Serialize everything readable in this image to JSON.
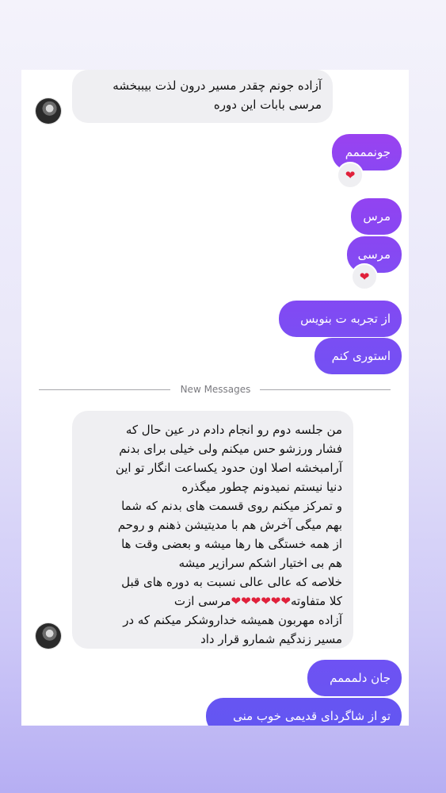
{
  "thread": {
    "msg1": {
      "lines": [
        "آزاده جونم چقدر مسیر درون لذت بیببخشه",
        "مرسی بابات این دوره"
      ]
    },
    "reply1": {
      "text": "جونمممم",
      "reaction": "❤"
    },
    "reply2": {
      "text": "مرس"
    },
    "reply3": {
      "text": "مرسی",
      "reaction": "❤"
    },
    "reply4": {
      "text": "از تجربه ت بنویس"
    },
    "reply5": {
      "text": "استوری کنم"
    },
    "divider": {
      "label": "New Messages"
    },
    "msg2": {
      "lines": [
        "من جلسه دوم رو انجام دادم در عین حال که",
        "فشار ورزشو حس میکنم ولی خیلی برای بدنم",
        "آرامبخشه اصلا اون حدود یکساعت انگار تو این",
        "دنیا نیستم نمیدونم چطور میگذره",
        "و تمرکز میکنم روی قسمت های بدنم که شما",
        "بهم میگی آخرش هم با مدیتیشن ذهنم و روحم",
        "از همه خستگی ها رها میشه و بعضی وقت ها",
        "هم بی اختیار اشکم سرازیر میشه",
        "خلاصه که عالی عالی نسبت به دوره های قبل",
        "کلا متفاوته",
        "مرسی ازت",
        "آزاده مهربون همیشه خداروشکر میکنم که در",
        "مسیر زندگیم شمارو قرار داد"
      ],
      "hearts": "❤❤❤❤❤❤"
    },
    "reply6": {
      "text": "جان دلمممم"
    },
    "reply7": {
      "text": "تو از شاگردای قدیمی خوب منی"
    }
  },
  "colors": {
    "outgoing_top": "#8a48f2",
    "outgoing_bottom": "#5d55f0",
    "incoming": "#efeff2",
    "heart": "#e0203a"
  },
  "icons": [
    "profile-avatar-icon",
    "heart-reaction-icon"
  ]
}
